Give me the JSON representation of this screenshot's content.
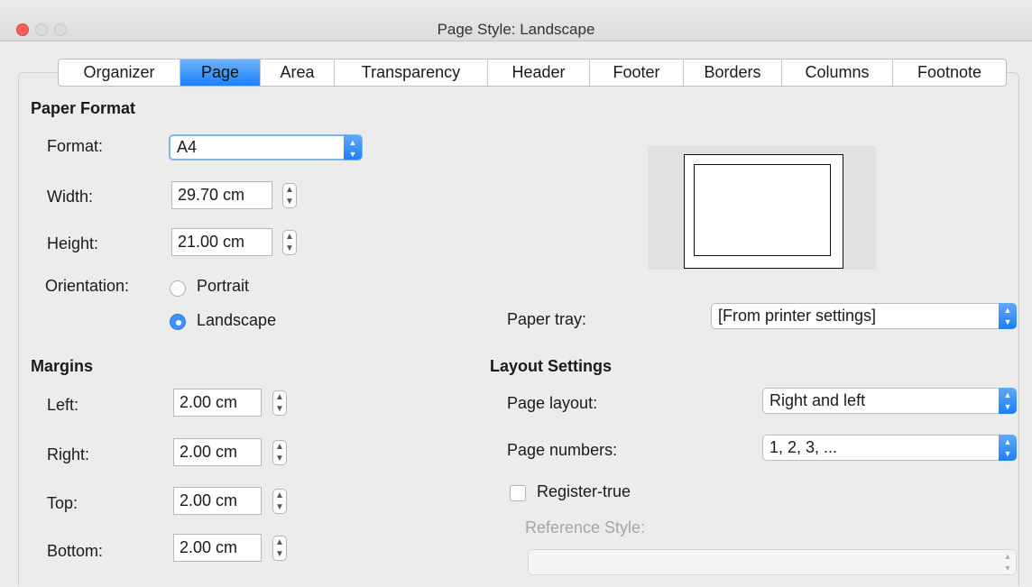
{
  "window": {
    "title": "Page Style: Landscape"
  },
  "tabs": [
    "Organizer",
    "Page",
    "Area",
    "Transparency",
    "Header",
    "Footer",
    "Borders",
    "Columns",
    "Footnote"
  ],
  "active_tab": "Page",
  "paper_format": {
    "heading": "Paper Format",
    "format_label": "Format:",
    "format_value": "A4",
    "width_label": "Width:",
    "width_value": "29.70 cm",
    "height_label": "Height:",
    "height_value": "21.00 cm",
    "orientation_label": "Orientation:",
    "portrait_label": "Portrait",
    "landscape_label": "Landscape",
    "orientation_selected": "Landscape"
  },
  "margins": {
    "heading": "Margins",
    "left_label": "Left:",
    "left_value": "2.00 cm",
    "right_label": "Right:",
    "right_value": "2.00 cm",
    "top_label": "Top:",
    "top_value": "2.00 cm",
    "bottom_label": "Bottom:",
    "bottom_value": "2.00 cm"
  },
  "paper_tray": {
    "label": "Paper tray:",
    "value": "[From printer settings]"
  },
  "layout_settings": {
    "heading": "Layout Settings",
    "page_layout_label": "Page layout:",
    "page_layout_value": "Right and left",
    "page_numbers_label": "Page numbers:",
    "page_numbers_value": "1, 2, 3, ...",
    "register_true_label": "Register-true",
    "register_true_checked": false,
    "reference_style_label": "Reference Style:",
    "reference_style_value": ""
  },
  "colors": {
    "accent": "#1a82fb",
    "close_button": "#fc5f57",
    "disabled_text": "#a6a6a6"
  }
}
